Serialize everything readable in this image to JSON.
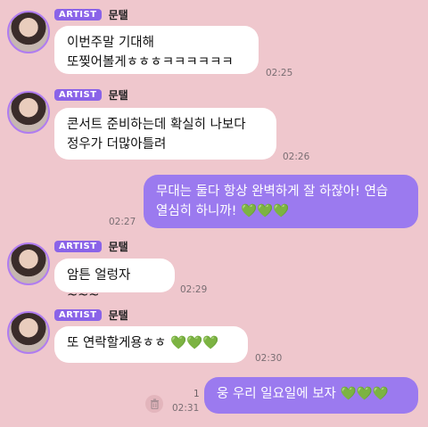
{
  "messages": [
    {
      "sender_badge": "ARTIST",
      "sender": "문탤",
      "line1": "이번주말 기대해",
      "line2": "또찢어볼게ㅎㅎㅎㅋㅋㅋㅋㅋㅋ",
      "time": "02:25"
    },
    {
      "sender_badge": "ARTIST",
      "sender": "문탤",
      "line1": "콘서트 준비하는데 확실히 나보다",
      "line2": "정우가 더많아틀려",
      "time": "02:26"
    },
    {
      "from_me": true,
      "line1": "무대는 둘다 항상 완벽하게 잘 하잖아! 연습",
      "line2": "열심히 하니까!",
      "hearts": "💚💚💚",
      "time": "02:27"
    },
    {
      "sender_badge": "ARTIST",
      "sender": "문탤",
      "line1": "암튼 얼렁자~~~",
      "time": "02:29"
    },
    {
      "sender_badge": "ARTIST",
      "sender": "문탤",
      "line1": "또 연락할게용ㅎㅎ",
      "hearts": "💚💚💚",
      "time": "02:30"
    },
    {
      "from_me": true,
      "line1": "웅 우리 일요일에 보자",
      "hearts": "💚💚💚",
      "unread": "1",
      "time": "02:31"
    }
  ],
  "colors": {
    "background": "#efc7cd",
    "outgoing_bubble": "#9b7aef",
    "artist_badge": "#8a63e8"
  },
  "icons": {
    "delete": "trash-icon",
    "heart": "green-heart-emoji"
  }
}
